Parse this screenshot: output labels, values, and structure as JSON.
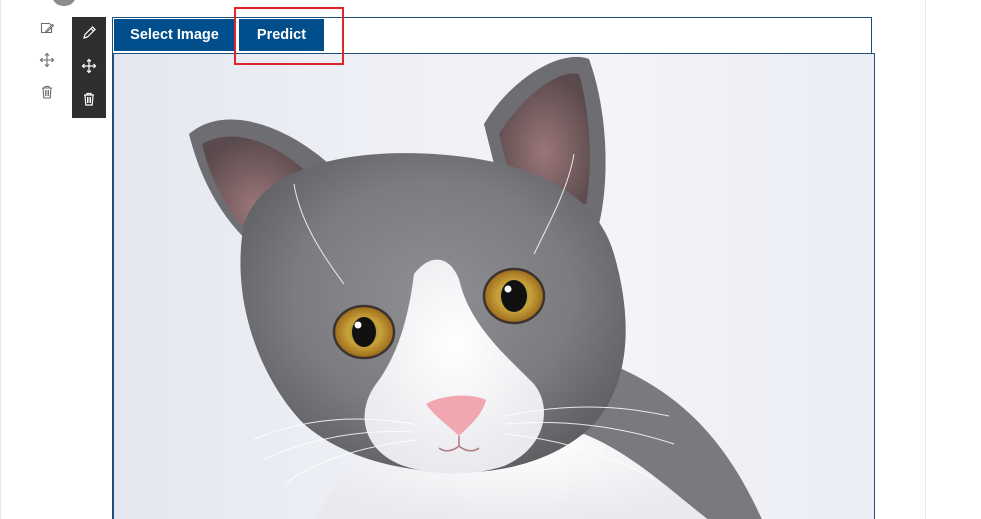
{
  "toolbar": {
    "select_image_label": "Select Image",
    "predict_label": "Predict"
  },
  "icons": {
    "section_edit": "edit-icon",
    "section_move": "move-icon",
    "section_delete": "trash-icon",
    "webpart_edit": "pencil-icon",
    "webpart_move": "move-icon",
    "webpart_delete": "trash-icon"
  },
  "image": {
    "subject": "gray-and-white-cat-photo"
  },
  "colors": {
    "button_bg": "#004e8c",
    "button_text": "#ffffff",
    "highlight": "#e0242b",
    "toolbar_bg": "#2f2f2f",
    "frame_border": "#1f4e79"
  }
}
